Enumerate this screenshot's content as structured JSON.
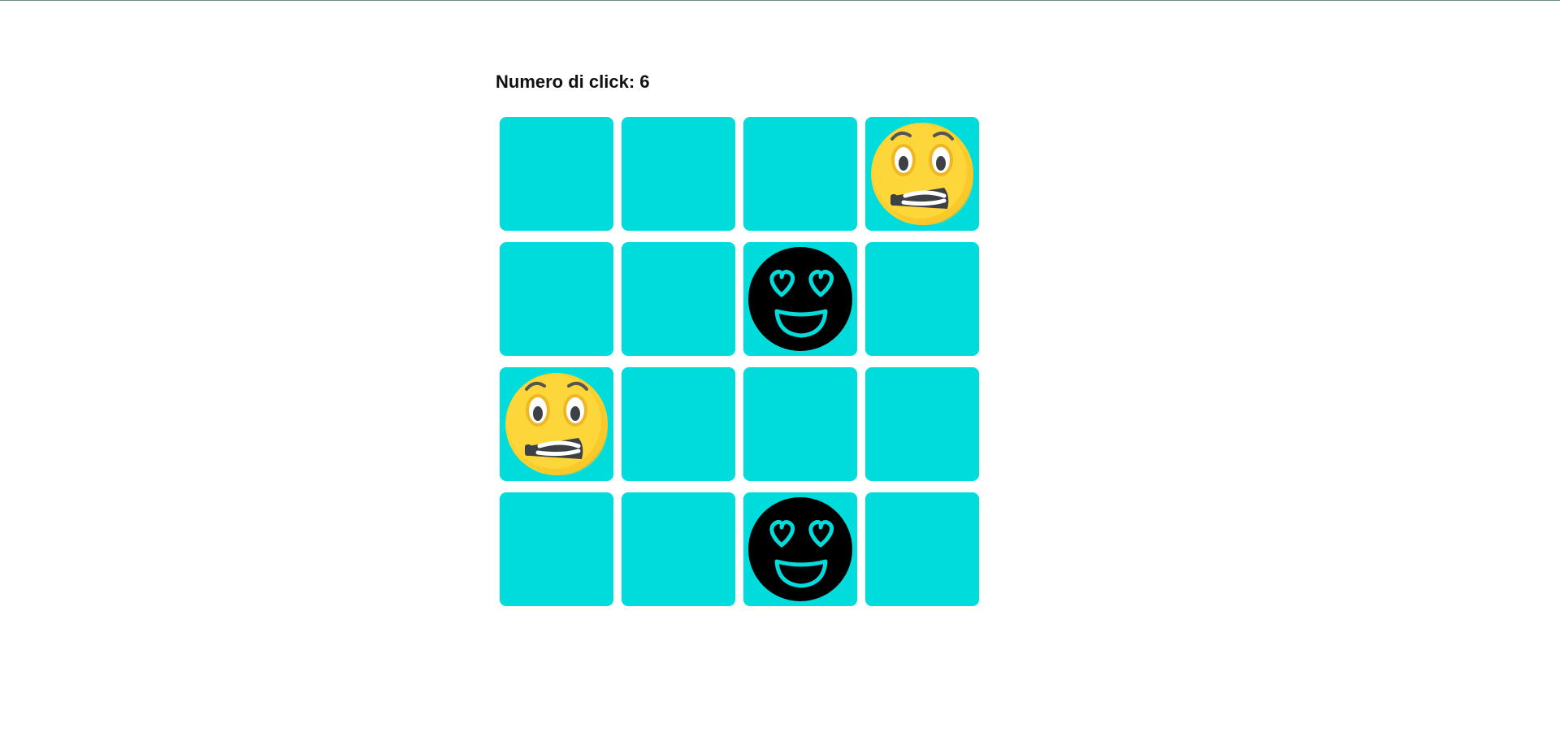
{
  "counter": {
    "label": "Numero di click: 6"
  },
  "colors": {
    "card_back": "#00dbdc",
    "background": "#ffffff"
  },
  "board": {
    "rows": 4,
    "cols": 4,
    "cards": [
      {
        "face": "hidden"
      },
      {
        "face": "hidden"
      },
      {
        "face": "hidden"
      },
      {
        "face": "grimacing-face-icon"
      },
      {
        "face": "hidden"
      },
      {
        "face": "hidden"
      },
      {
        "face": "heart-eyes-face-icon"
      },
      {
        "face": "hidden"
      },
      {
        "face": "grimacing-face-icon"
      },
      {
        "face": "hidden"
      },
      {
        "face": "hidden"
      },
      {
        "face": "hidden"
      },
      {
        "face": "hidden"
      },
      {
        "face": "hidden"
      },
      {
        "face": "heart-eyes-face-icon"
      },
      {
        "face": "hidden"
      }
    ]
  }
}
